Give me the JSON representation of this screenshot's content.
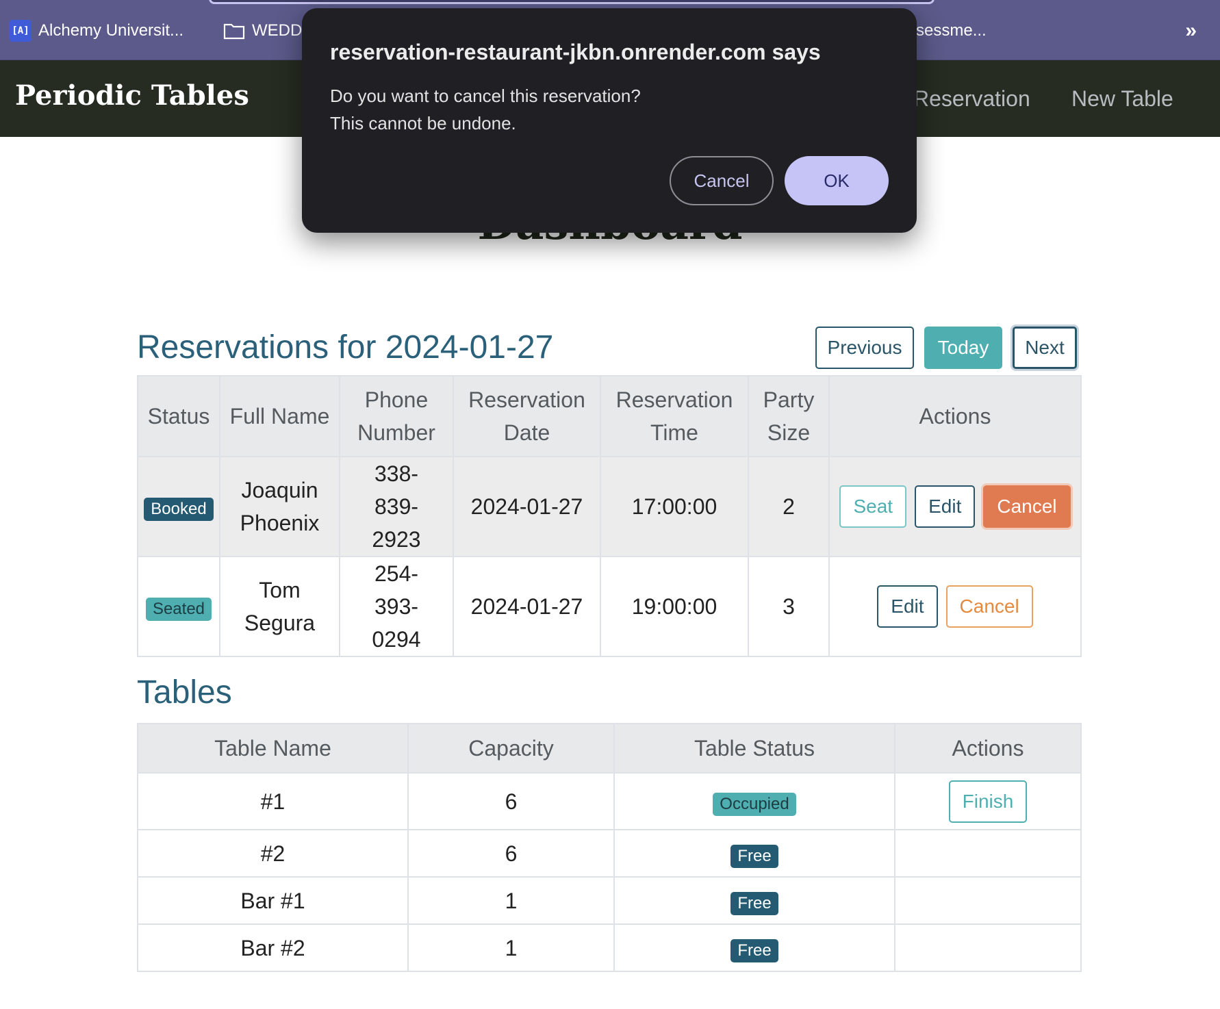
{
  "bookmarks": {
    "items": [
      {
        "label": "Alchemy Universit...",
        "icon": "alchemy-favicon",
        "icon_text": "[A]"
      },
      {
        "label": "WEDD",
        "icon": "folder-icon"
      },
      {
        "label": "ssessme...",
        "icon": ""
      }
    ],
    "more_icon": "»"
  },
  "app": {
    "brand": "Periodic Tables",
    "nav": [
      {
        "label": "Reservation"
      },
      {
        "label": "New Table"
      }
    ],
    "page_title": "Dashboard"
  },
  "reservations": {
    "heading": "Reservations for 2024-01-27",
    "buttons": {
      "previous": "Previous",
      "today": "Today",
      "next": "Next"
    },
    "columns": [
      "Status",
      "Full Name",
      "Phone Number",
      "Reservation Date",
      "Reservation Time",
      "Party Size",
      "Actions"
    ],
    "rows": [
      {
        "status": "Booked",
        "name": "Joaquin Phoenix",
        "phone": "338-839-2923",
        "date": "2024-01-27",
        "time": "17:00:00",
        "party": "2",
        "actions": {
          "seat": "Seat",
          "edit": "Edit",
          "cancel": "Cancel"
        }
      },
      {
        "status": "Seated",
        "name": "Tom Segura",
        "phone": "254-393-0294",
        "date": "2024-01-27",
        "time": "19:00:00",
        "party": "3",
        "actions": {
          "edit": "Edit",
          "cancel": "Cancel"
        }
      }
    ]
  },
  "tables": {
    "heading": "Tables",
    "columns": [
      "Table Name",
      "Capacity",
      "Table Status",
      "Actions"
    ],
    "rows": [
      {
        "name": "#1",
        "capacity": "6",
        "status": "Occupied",
        "action": "Finish"
      },
      {
        "name": "#2",
        "capacity": "6",
        "status": "Free",
        "action": ""
      },
      {
        "name": "Bar #1",
        "capacity": "1",
        "status": "Free",
        "action": ""
      },
      {
        "name": "Bar #2",
        "capacity": "1",
        "status": "Free",
        "action": ""
      }
    ]
  },
  "dialog": {
    "title": "reservation-restaurant-jkbn.onrender.com says",
    "message_line1": "Do you want to cancel this reservation?",
    "message_line2": "This cannot be undone.",
    "cancel_label": "Cancel",
    "ok_label": "OK"
  },
  "colors": {
    "bookmarks_bar": "#5b5a8a",
    "navbar": "#262c22",
    "heading_blue": "#2a6079",
    "teal": "#4faeb0",
    "orange": "#e07a51",
    "dialog_bg": "#1f1f24",
    "dialog_ok": "#c6c4f7"
  }
}
